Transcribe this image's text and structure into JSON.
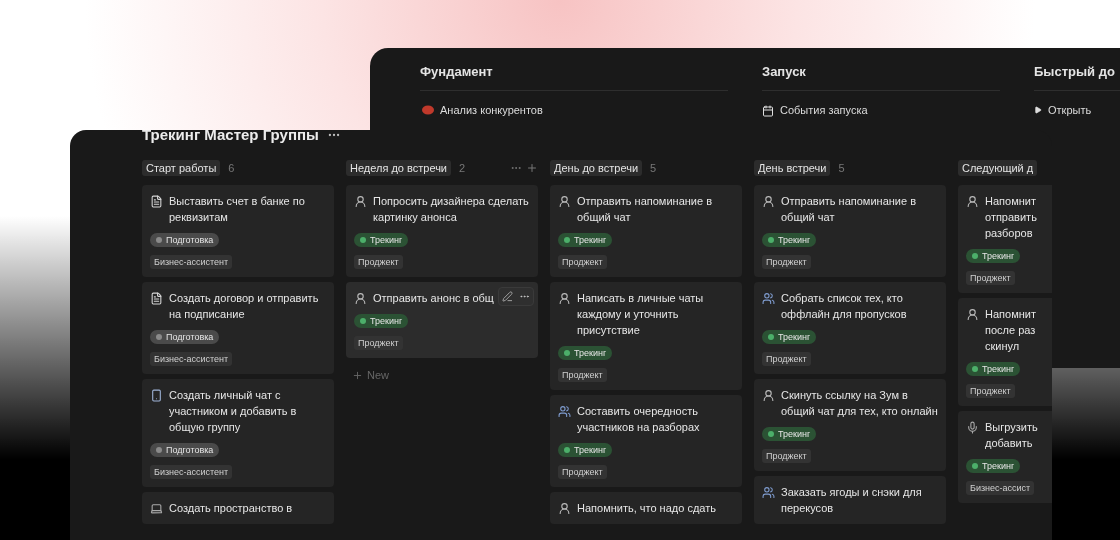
{
  "back_window": {
    "sections": [
      {
        "title": "Фундамент",
        "items": [
          {
            "kind": "glove",
            "label": "Анализ конкурентов"
          }
        ]
      },
      {
        "title": "Запуск",
        "items": [
          {
            "kind": "calendar",
            "label": "События запуска"
          }
        ]
      },
      {
        "title": "Быстрый до",
        "items": [
          {
            "kind": "toggle",
            "label": "Открыть"
          }
        ]
      }
    ]
  },
  "board": {
    "title": "Трекинг Мастер Группы",
    "columns": [
      {
        "name": "Старт работы",
        "count": "6",
        "cards": [
          {
            "kind": "doc",
            "title": "Выставить счет в банке по реквизитам",
            "status": {
              "label": "Подготовка",
              "color": "#8a8a8a"
            },
            "tag": "Бизнес-ассистент"
          },
          {
            "kind": "doc",
            "title": "Создать договор и отправить на подписание",
            "status": {
              "label": "Подготовка",
              "color": "#8a8a8a"
            },
            "tag": "Бизнес-ассистент"
          },
          {
            "kind": "phone",
            "title": "Создать личный чат с участником и добавить в общую группу",
            "status": {
              "label": "Подготовка",
              "color": "#8a8a8a"
            },
            "tag": "Бизнес-ассистент"
          },
          {
            "kind": "laptop",
            "title": "Создать пространство в"
          }
        ]
      },
      {
        "name": "Неделя до встречи",
        "count": "2",
        "actions": true,
        "new_label": "New",
        "cards": [
          {
            "kind": "person",
            "title": "Попросить дизайнера сделать картинку анонса",
            "status": {
              "label": "Трекинг",
              "color": "#4caf6a"
            },
            "tag": "Проджект"
          },
          {
            "kind": "person",
            "title": "Отправить анонс в общ",
            "hovered": true,
            "status": {
              "label": "Трекинг",
              "color": "#4caf6a"
            },
            "tag": "Проджект"
          }
        ]
      },
      {
        "name": "День до встречи",
        "count": "5",
        "cards": [
          {
            "kind": "person",
            "title": "Отправить напоминание в общий чат",
            "status": {
              "label": "Трекинг",
              "color": "#4caf6a"
            },
            "tag": "Проджект"
          },
          {
            "kind": "person",
            "title": "Написать в личные чаты каждому и уточнить присутствие",
            "status": {
              "label": "Трекинг",
              "color": "#4caf6a"
            },
            "tag": "Проджект"
          },
          {
            "kind": "people",
            "title": "Составить очередность участников на разборах",
            "status": {
              "label": "Трекинг",
              "color": "#4caf6a"
            },
            "tag": "Проджект"
          },
          {
            "kind": "person",
            "title": "Напомнить, что надо сдать"
          }
        ]
      },
      {
        "name": "День встречи",
        "count": "5",
        "cards": [
          {
            "kind": "person",
            "title": "Отправить напоминание в общий чат",
            "status": {
              "label": "Трекинг",
              "color": "#4caf6a"
            },
            "tag": "Проджект"
          },
          {
            "kind": "people",
            "title": "Собрать список тех, кто оффлайн для пропусков",
            "status": {
              "label": "Трекинг",
              "color": "#4caf6a"
            },
            "tag": "Проджект"
          },
          {
            "kind": "person",
            "title": "Скинуть ссылку на Зум в общий чат для тех, кто онлайн",
            "status": {
              "label": "Трекинг",
              "color": "#4caf6a"
            },
            "tag": "Проджект"
          },
          {
            "kind": "people",
            "title": "Заказать ягоды и снэки для перекусов"
          }
        ]
      },
      {
        "name": "Следующий д",
        "cards": [
          {
            "kind": "person",
            "title": "Напомнит\nотправить\nразборов",
            "status": {
              "label": "Трекинг",
              "color": "#4caf6a"
            },
            "tag": "Проджект"
          },
          {
            "kind": "person",
            "title": "Напомнит\nпосле раз\nскинул",
            "status": {
              "label": "Трекинг",
              "color": "#4caf6a"
            },
            "tag": "Проджект"
          },
          {
            "kind": "mic",
            "title": "Выгрузить\nдобавить",
            "status": {
              "label": "Трекинг",
              "color": "#4caf6a"
            },
            "tag": "Бизнес-ассист"
          }
        ]
      }
    ]
  }
}
